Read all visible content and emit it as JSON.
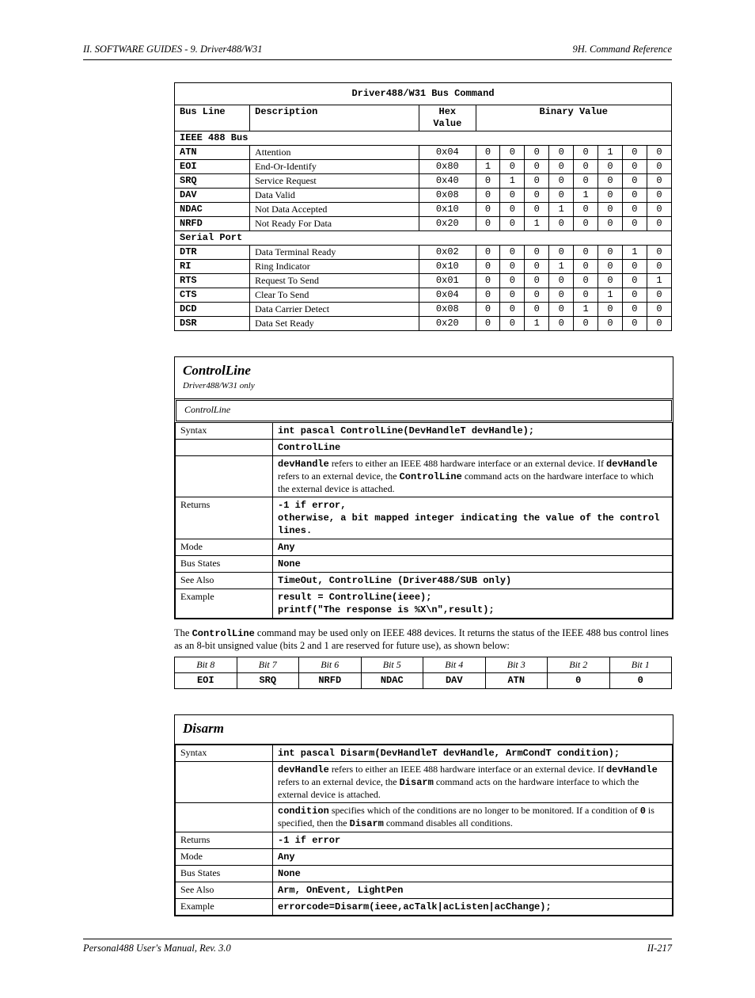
{
  "header": {
    "left": "II. SOFTWARE GUIDES - 9. Driver488/W31",
    "right": "9H. Command Reference"
  },
  "footer": {
    "left": "Personal488 User's Manual, Rev. 3.0",
    "right": "II-217"
  },
  "busTable": {
    "title": "Driver488/W31 Bus Command",
    "colHeaders": {
      "name": "Bus Line",
      "desc": "Description",
      "hex": "Hex Value",
      "bits": "Binary Value"
    },
    "bitGroupA": "IEEE 488 Bus",
    "bitGroupB": "Serial Port",
    "rowsA": [
      {
        "name": "ATN",
        "desc": "Attention",
        "hex": "0x04",
        "bits": [
          "0",
          "0",
          "0",
          "0",
          "0",
          "1",
          "0",
          "0"
        ]
      },
      {
        "name": "EOI",
        "desc": "End-Or-Identify",
        "hex": "0x80",
        "bits": [
          "1",
          "0",
          "0",
          "0",
          "0",
          "0",
          "0",
          "0"
        ]
      },
      {
        "name": "SRQ",
        "desc": "Service Request",
        "hex": "0x40",
        "bits": [
          "0",
          "1",
          "0",
          "0",
          "0",
          "0",
          "0",
          "0"
        ]
      },
      {
        "name": "DAV",
        "desc": "Data Valid",
        "hex": "0x08",
        "bits": [
          "0",
          "0",
          "0",
          "0",
          "1",
          "0",
          "0",
          "0"
        ]
      },
      {
        "name": "NDAC",
        "desc": "Not Data Accepted",
        "hex": "0x10",
        "bits": [
          "0",
          "0",
          "0",
          "1",
          "0",
          "0",
          "0",
          "0"
        ]
      },
      {
        "name": "NRFD",
        "desc": "Not Ready For Data",
        "hex": "0x20",
        "bits": [
          "0",
          "0",
          "1",
          "0",
          "0",
          "0",
          "0",
          "0"
        ]
      }
    ],
    "rowsB": [
      {
        "name": "DTR",
        "desc": "Data Terminal Ready",
        "hex": "0x02",
        "bits": [
          "0",
          "0",
          "0",
          "0",
          "0",
          "0",
          "1",
          "0"
        ]
      },
      {
        "name": "RI",
        "desc": "Ring Indicator",
        "hex": "0x10",
        "bits": [
          "0",
          "0",
          "0",
          "1",
          "0",
          "0",
          "0",
          "0"
        ]
      },
      {
        "name": "RTS",
        "desc": "Request To Send",
        "hex": "0x01",
        "bits": [
          "0",
          "0",
          "0",
          "0",
          "0",
          "0",
          "0",
          "1"
        ]
      },
      {
        "name": "CTS",
        "desc": "Clear To Send",
        "hex": "0x04",
        "bits": [
          "0",
          "0",
          "0",
          "0",
          "0",
          "1",
          "0",
          "0"
        ]
      },
      {
        "name": "DCD",
        "desc": "Data Carrier Detect",
        "hex": "0x08",
        "bits": [
          "0",
          "0",
          "0",
          "0",
          "1",
          "0",
          "0",
          "0"
        ]
      },
      {
        "name": "DSR",
        "desc": "Data Set Ready",
        "hex": "0x20",
        "bits": [
          "0",
          "0",
          "1",
          "0",
          "0",
          "0",
          "0",
          "0"
        ]
      }
    ]
  },
  "controlLine": {
    "title": "ControlLine",
    "subtitle": "Driver488/W31 only",
    "echo": "ControlLine",
    "rows": {
      "syntax_k": "Syntax",
      "syntax_v": "int pascal ControlLine(DevHandleT devHandle);",
      "devHandle": "devHandle",
      "refers": "refers to either an IEEE 488 hardware interface or an external device. If",
      "devHandle2": "devHandle",
      "refers2": " refers to an external device, the ",
      "controlline": "ControlLine",
      "refers3": " command acts on the hardware interface to which the external device is attached.",
      "returns_k": "Returns",
      "returns_l1": "-1 if error,",
      "returns_l2": "otherwise, a bit mapped integer indicating the value of the control lines.",
      "mode_k": "Mode",
      "mode_v": "Any",
      "bus_k": "Bus States",
      "bus_v": "None",
      "see_k": "See Also",
      "see_v": "TimeOut, ControlLine (Driver488/SUB only)",
      "ex_k": "Example",
      "ex_l1": "result = ControlLine(ieee);",
      "ex_l2": "printf(\"The response is %X\\n\",result);"
    },
    "para_pre": "The ",
    "para_code": "ControlLine",
    "para_post": " command may be used only on IEEE 488 devices. It returns the status of the IEEE 488 bus control lines as an 8-bit unsigned value (bits 2 and 1 are reserved for future use), as shown below:",
    "bits": {
      "row1": [
        "Bit 8",
        "Bit 7",
        "Bit 6",
        "Bit 5",
        "Bit 4",
        "Bit 3",
        "Bit 2",
        "Bit 1"
      ],
      "row2": [
        "EOI",
        "SRQ",
        "NRFD",
        "NDAC",
        "DAV",
        "ATN",
        "0",
        "0"
      ]
    }
  },
  "disarm": {
    "title": "Disarm",
    "rows": {
      "syntax_k": "Syntax",
      "syntax_v": "int pascal Disarm(DevHandleT devHandle, ArmCondT condition);",
      "devHandle": "devHandle",
      "dh_t1": "refers to either an IEEE 488 hardware interface or an external device. If",
      "devHandle2": "devHandle",
      "dh_t2": " refers to an external device, the ",
      "disarm_b": "Disarm",
      "dh_t3": " command acts on the hardware interface to which the external device is attached.",
      "cond": "condition",
      "cond_t1": " specifies which of the conditions are no longer to be monitored. If a",
      "cond_t2": "condition of ",
      "zero": "0",
      "cond_t3": " is specified, then the ",
      "disarm_b2": "Disarm",
      "cond_t4": " command disables all conditions.",
      "returns_k": "Returns",
      "returns_v": "-1 if error",
      "mode_k": "Mode",
      "mode_v": "Any",
      "bus_k": "Bus States",
      "bus_v": "None",
      "see_k": "See Also",
      "see_v": "Arm, OnEvent, LightPen",
      "ex_k": "Example",
      "ex_v": "errorcode=Disarm(ieee,acTalk|acListen|acChange);"
    }
  }
}
